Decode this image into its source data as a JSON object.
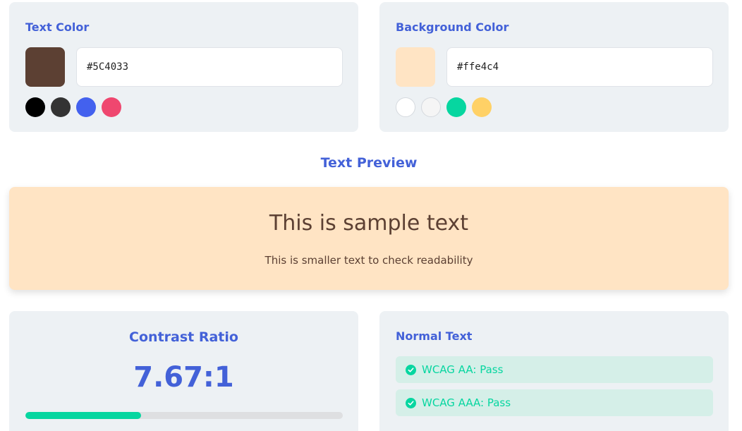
{
  "text_color": {
    "title": "Text Color",
    "value": "#5C4033",
    "swatch": "#5c4033",
    "presets": [
      "#000000",
      "#333333",
      "#4361ee",
      "#ef476f"
    ]
  },
  "background_color": {
    "title": "Background Color",
    "value": "#ffe4c4",
    "swatch": "#ffe4c4",
    "presets": [
      "#ffffff",
      "#f5f5f5",
      "#06d6a0",
      "#ffd166"
    ]
  },
  "preview": {
    "title": "Text Preview",
    "large_text": "This is sample text",
    "small_text": "This is smaller text to check readability"
  },
  "contrast": {
    "title": "Contrast Ratio",
    "value": "7.67:1",
    "progress_fraction": 0.365,
    "bar_color": "#06d6a0"
  },
  "normal_text": {
    "title": "Normal Text",
    "results": [
      {
        "label": "WCAG AA: Pass",
        "icon": "check-circle-icon"
      },
      {
        "label": "WCAG AAA: Pass",
        "icon": "check-circle-icon"
      }
    ],
    "pass_color": "#06d6a0"
  }
}
